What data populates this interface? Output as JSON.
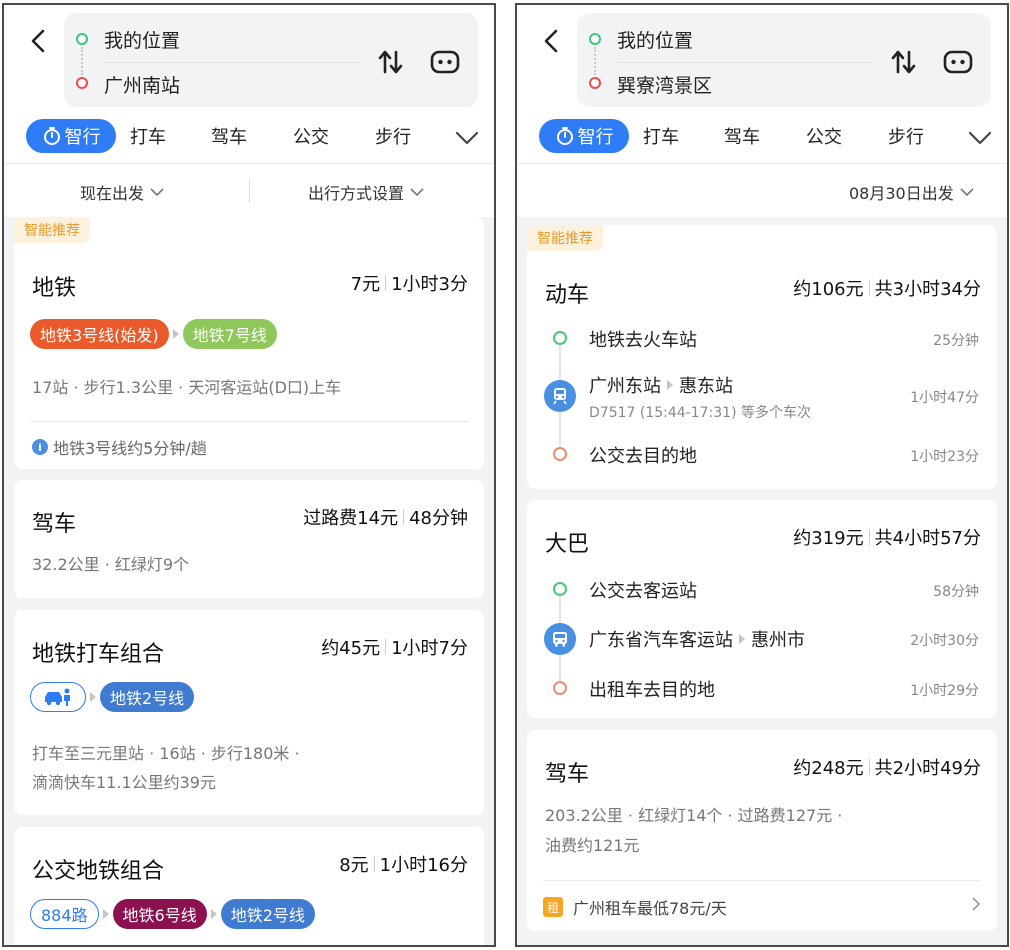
{
  "left": {
    "from": "我的位置",
    "to": "广州南站",
    "tabs": [
      "智行",
      "打车",
      "驾车",
      "公交",
      "步行"
    ],
    "filters": {
      "depart": "现在出发",
      "mode": "出行方式设置"
    },
    "cards": {
      "metro": {
        "badge": "智能推荐",
        "title": "地铁",
        "price": "7元",
        "duration": "1小时3分",
        "chips": [
          {
            "label": "地铁3号线(始发)",
            "color": "#ea5a2a"
          },
          {
            "label": "地铁7号线",
            "color": "#8fc85a"
          }
        ],
        "detail": "17站 · 步行1.3公里 · 天河客运站(D口)上车",
        "tip": "地铁3号线约5分钟/趟"
      },
      "drive": {
        "title": "驾车",
        "price": "过路费14元",
        "duration": "48分钟",
        "detail": "32.2公里 · 红绿灯9个"
      },
      "metro_taxi": {
        "title": "地铁打车组合",
        "price": "约45元",
        "duration": "1小时7分",
        "chips": [
          {
            "label": "地铁2号线",
            "color": "#3f7bd0"
          }
        ],
        "detail1": "打车至三元里站 · 16站 · 步行180米 ·",
        "detail2": "滴滴快车11.1公里约39元"
      },
      "bus_metro": {
        "title": "公交地铁组合",
        "price": "8元",
        "duration": "1小时16分",
        "chips": [
          {
            "label": "884路",
            "color": "#2e7cf6"
          },
          {
            "label": "地铁6号线",
            "color": "#8c1150"
          },
          {
            "label": "地铁2号线",
            "color": "#3f7bd0"
          }
        ]
      }
    }
  },
  "right": {
    "from": "我的位置",
    "to": "巽寮湾景区",
    "tabs": [
      "智行",
      "打车",
      "驾车",
      "公交",
      "步行"
    ],
    "filters": {
      "depart": "08月30日出发"
    },
    "cards": {
      "train": {
        "badge": "智能推荐",
        "title": "动车",
        "price": "约106元",
        "duration": "共3小时34分",
        "steps": [
          {
            "text": "地铁去火车站",
            "time": "25分钟"
          },
          {
            "from": "广州东站",
            "to": "惠东站",
            "sub": "D7517 (15:44-17:31) 等多个车次",
            "time": "1小时47分"
          },
          {
            "text": "公交去目的地",
            "time": "1小时23分"
          }
        ]
      },
      "coach": {
        "title": "大巴",
        "price": "约319元",
        "duration": "共4小时57分",
        "steps": [
          {
            "text": "公交去客运站",
            "time": "58分钟"
          },
          {
            "from": "广东省汽车客运站",
            "to": "惠州市",
            "time": "2小时30分"
          },
          {
            "text": "出租车去目的地",
            "time": "1小时29分"
          }
        ]
      },
      "drive": {
        "title": "驾车",
        "price": "约248元",
        "duration": "共2小时49分",
        "detail1": "203.2公里 · 红绿灯14个 · 过路费127元 ·",
        "detail2": "油费约121元",
        "rent_icon": "租",
        "rent_text": "广州租车最低78元/天"
      }
    }
  }
}
